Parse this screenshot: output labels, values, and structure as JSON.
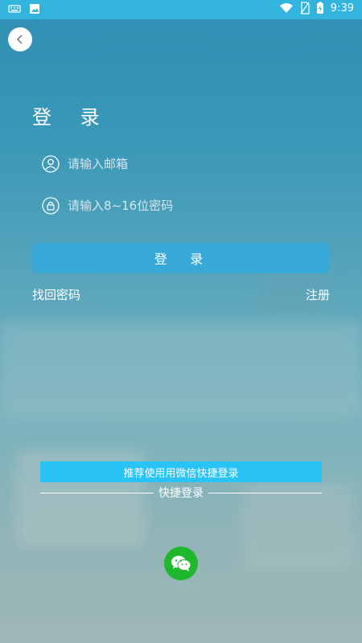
{
  "status": {
    "time": "9:39"
  },
  "login": {
    "title": "登 录",
    "email_placeholder": "请输入邮箱",
    "password_placeholder": "请输入8~16位密码",
    "button_label": "登 录",
    "forgot_label": "找回密码",
    "register_label": "注册"
  },
  "quick": {
    "banner_text": "推荐使用用微信快捷登录",
    "divider_text": "快捷登录"
  },
  "colors": {
    "statusbar": "#33b4dd",
    "button": "#37a9d8",
    "banner": "#29c3f5",
    "wechat": "#1fb82d"
  },
  "icons": [
    "keyboard-icon",
    "image-icon",
    "wifi-icon",
    "no-sim-icon",
    "battery-charging-icon",
    "back-icon",
    "user-icon",
    "lock-icon",
    "wechat-icon"
  ]
}
